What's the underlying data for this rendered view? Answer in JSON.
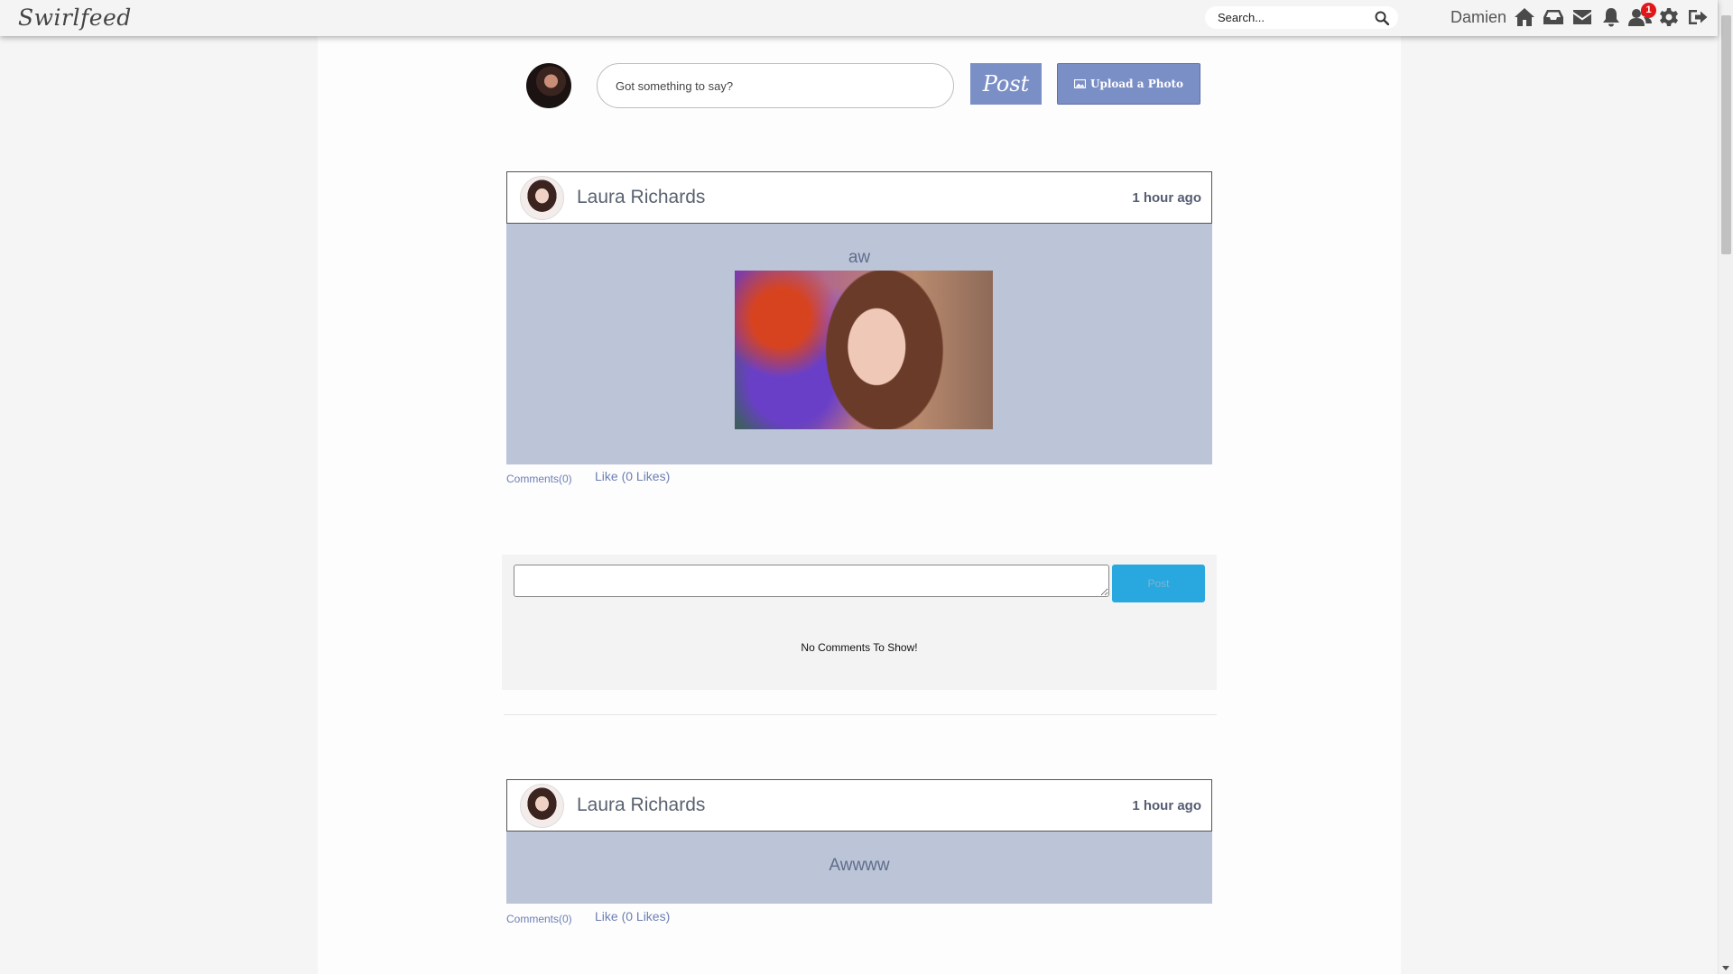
{
  "app": {
    "logo": "Swirlfeed"
  },
  "nav": {
    "search_placeholder": "Search...",
    "username": "Damien",
    "icons": [
      "home-icon",
      "inbox-icon",
      "envelope-icon",
      "bell-icon",
      "friend-requests-icon",
      "gear-icon",
      "logout-icon"
    ],
    "friend_request_count": "1"
  },
  "composer": {
    "placeholder": "Got something to say?",
    "post_label": "Post",
    "upload_label": "Upload a Photo"
  },
  "posts": [
    {
      "author": "Laura Richards",
      "time": "1 hour ago",
      "text": "aw",
      "has_image": true,
      "comments_label": "Comments(0)",
      "like_label": "Like (0 Likes)"
    },
    {
      "author": "Laura Richards",
      "time": "1 hour ago",
      "text": "Awwww",
      "has_image": false,
      "comments_label": "Comments(0)",
      "like_label": "Like (0 Likes)"
    }
  ],
  "comment_section": {
    "post_label": "Post",
    "empty_text": "No Comments To Show!"
  },
  "colors": {
    "accent": "#7b8fc7",
    "post_body_bg": "#bcc4d8",
    "link": "#6b7fb5",
    "comment_post_button": "#29a7df",
    "badge": "#e0181b"
  }
}
